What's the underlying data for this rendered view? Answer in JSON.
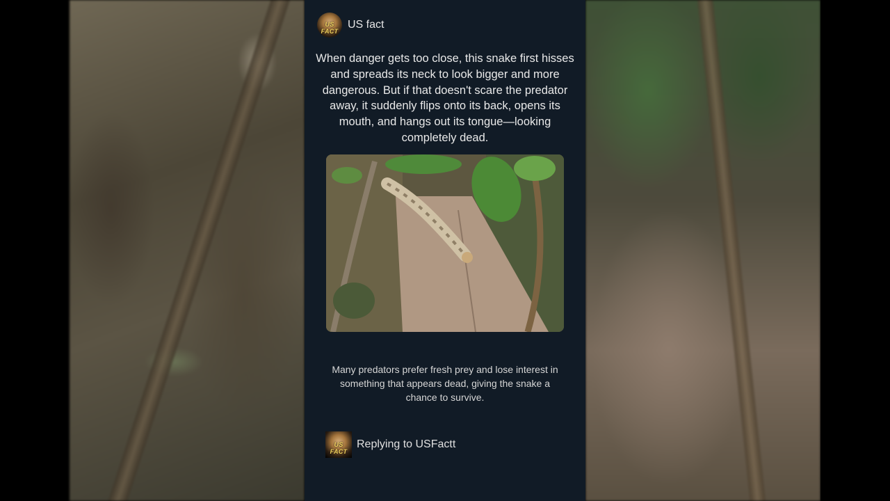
{
  "post": {
    "channel_name": "US fact",
    "avatar_text": "US FACT",
    "main_text": "When danger gets too close, this snake first hisses and spreads its neck to look bigger and more dangerous. But if that doesn't scare the predator away, it suddenly flips onto its back, opens its mouth, and hangs out its tongue—looking completely dead.",
    "secondary_text": "Many predators prefer fresh prey and lose interest in something that appears dead, giving the snake a chance to survive."
  },
  "reply": {
    "avatar_text": "US FACT",
    "text": "Replying to USFactt"
  },
  "colors": {
    "card_background": "#111b26",
    "text_primary": "#e9e9e9",
    "avatar_badge": "#f4d35e"
  }
}
